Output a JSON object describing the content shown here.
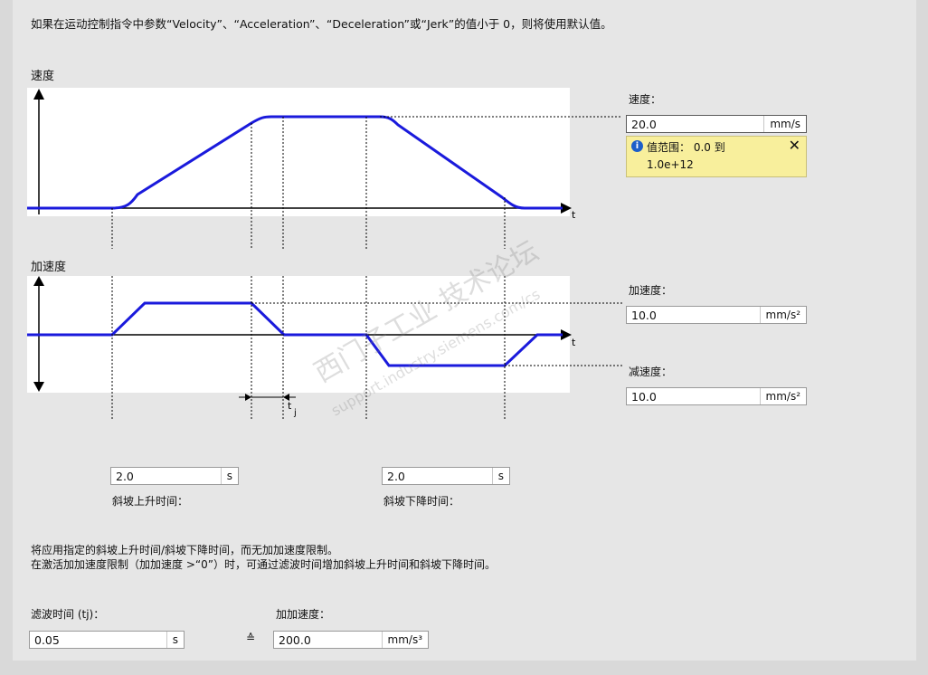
{
  "intro_text": "如果在运动控制指令中参数“Velocity”、“Acceleration”、“Deceleration”或“Jerk”的值小于 0，则将使用默认值。",
  "velocity_section_label": "速度",
  "acceleration_section_label": "加速度",
  "velocity": {
    "label": "速度：",
    "value": "20.0",
    "unit": "mm/s"
  },
  "tooltip": {
    "line1": "值范围：  0.0 到",
    "line2": "1.0e+12",
    "close": "✕"
  },
  "acceleration": {
    "label": "加速度：",
    "value": "10.0",
    "unit": "mm/s²"
  },
  "deceleration": {
    "label": "减速度：",
    "value": "10.0",
    "unit": "mm/s²"
  },
  "ramp_up": {
    "value": "2.0",
    "unit": "s",
    "label": "斜坡上升时间："
  },
  "ramp_down": {
    "value": "2.0",
    "unit": "s",
    "label": "斜坡下降时间："
  },
  "axis_t": "t",
  "tj_label": "t",
  "tj_sub": "j",
  "note_line1": "将应用指定的斜坡上升时间/斜坡下降时间，而无加加速度限制。",
  "note_line2": "在激活加加速度限制（加加速度 >“0”）时，可通过滤波时间增加斜坡上升时间和斜坡下降时间。",
  "filter_time": {
    "label": "滤波时间 (tj)：",
    "value": "0.05",
    "unit": "s"
  },
  "jerk": {
    "label": "加加速度：",
    "value": "200.0",
    "unit": "mm/s³"
  },
  "equiv_symbol": "≙",
  "watermark": {
    "line1": "西门子工业  技术论坛",
    "line2": "support.industry.siemens.com/cs"
  },
  "colors": {
    "curve": "#1a1adc",
    "plot_bg": "#ffffff",
    "tooltip_bg": "#f8ef9c",
    "info_icon": "#1d5fc9"
  }
}
